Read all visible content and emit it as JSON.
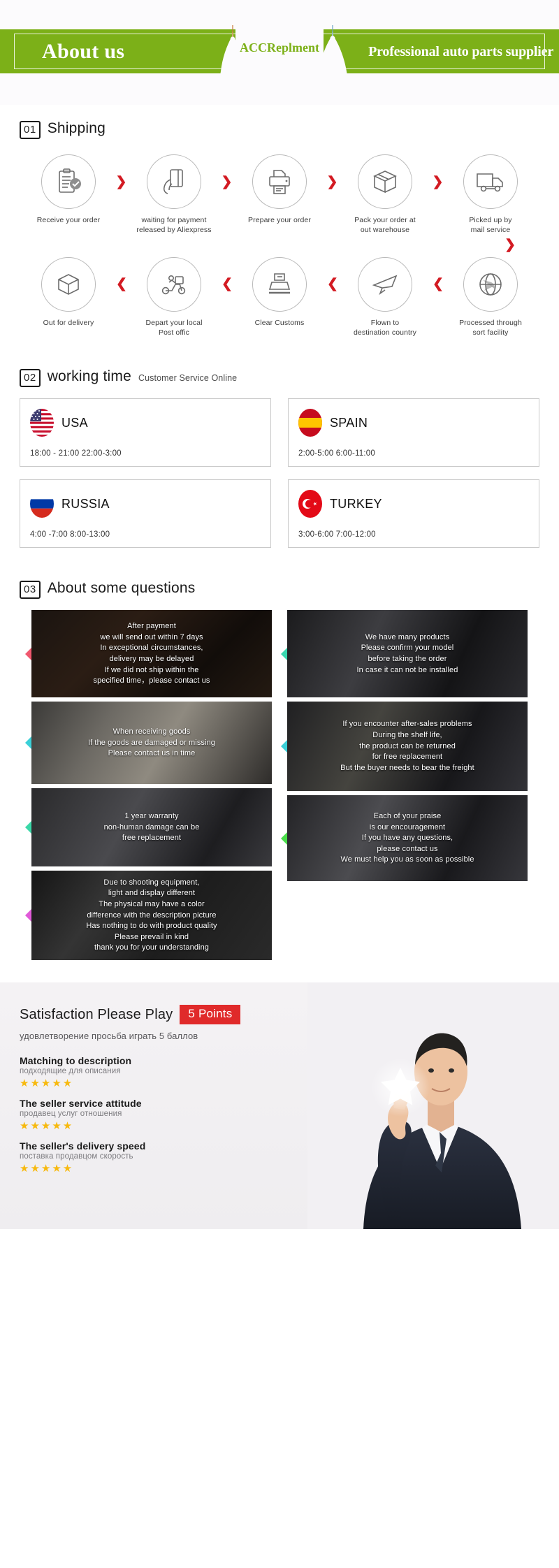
{
  "header": {
    "left_title": "About us",
    "brand": "ACCReplment",
    "right_title": "Professional auto parts supplier",
    "bar_color": "#7cb018"
  },
  "shipping": {
    "number": "01",
    "title": "Shipping",
    "arrow_color": "#d31a22",
    "row1": [
      {
        "icon": "clipboard-check-icon",
        "label": "Receive your order"
      },
      {
        "icon": "hand-card-icon",
        "label": "waiting for payment\nreleased by Aliexpress"
      },
      {
        "icon": "printer-icon",
        "label": "Prepare your order"
      },
      {
        "icon": "package-box-icon",
        "label": "Pack your order at\nout warehouse"
      },
      {
        "icon": "delivery-truck-icon",
        "label": "Picked up by\nmail service"
      }
    ],
    "row2": [
      {
        "icon": "open-box-icon",
        "label": "Out  for delivery"
      },
      {
        "icon": "scooter-courier-icon",
        "label": "Depart your local\nPost offic"
      },
      {
        "icon": "customs-stamp-icon",
        "label": "Clear Customs"
      },
      {
        "icon": "airplane-icon",
        "label": "Flown to\ndestination country"
      },
      {
        "icon": "globe-icon",
        "label": "Processed through\nsort facility"
      }
    ]
  },
  "worktime": {
    "number": "02",
    "title": "working time",
    "subtitle": "Customer Service Online",
    "cards": [
      {
        "flag": "usa-flag-icon",
        "country": "USA",
        "hours": "18:00 - 21:00   22:00-3:00"
      },
      {
        "flag": "spain-flag-icon",
        "country": "SPAIN",
        "hours": "2:00-5:00     6:00-11:00"
      },
      {
        "flag": "russia-flag-icon",
        "country": "RUSSIA",
        "hours": "4:00 -7:00   8:00-13:00"
      },
      {
        "flag": "turkey-flag-icon",
        "country": "TURKEY",
        "hours": "3:00-6:00    7:00-12:00"
      }
    ]
  },
  "questions": {
    "number": "03",
    "title": "About some questions",
    "left": [
      {
        "tip_color": "#f0576e",
        "text": "After payment\nwe will send out within 7 days\nIn exceptional circumstances,\ndelivery may be delayed\nIf we did not ship within the\nspecified time，please contact us"
      },
      {
        "tip_color": "#3ad0d8",
        "text": "When receiving goods\nIf the goods are damaged or missing\nPlease contact us in time"
      },
      {
        "tip_color": "#3ad8a8",
        "text": "1 year warranty\nnon-human damage can be\nfree replacement"
      },
      {
        "tip_color": "#e05ad8",
        "text": "Due to shooting equipment,\nlight and display different\nThe physical may have a color\ndifference with the description picture\nHas nothing to do with product quality\nPlease prevail in kind\nthank you for your understanding"
      }
    ],
    "right": [
      {
        "tip_color": "#3ad8b0",
        "text": "We have many products\nPlease confirm your model\nbefore taking the order\nIn case it can not be installed"
      },
      {
        "tip_color": "#3ad0d8",
        "text": "If you encounter after-sales problems\nDuring the shelf life,\nthe product can be returned\nfor free replacement\nBut the buyer needs to bear the freight"
      },
      {
        "tip_color": "#4ade4a",
        "text": "Each of your praise\nis our encouragement\nIf you have any questions,\nplease contact us\nWe must help you as soon as possible"
      }
    ]
  },
  "satisfaction": {
    "title": "Satisfaction Please Play",
    "badge": "5 Points",
    "badge_color": "#e02a2a",
    "subtitle": "удовлетворение просьба играть 5 баллов",
    "star_color": "#f7b90e",
    "ratings": [
      {
        "en": "Matching to description",
        "ru": "подходящие для описания",
        "stars": "★★★★★"
      },
      {
        "en": "The seller service attitude",
        "ru": "продавец услуг отношения",
        "stars": "★★★★★"
      },
      {
        "en": "The seller's delivery speed",
        "ru": "поставка продавцом скорость",
        "stars": "★★★★★"
      }
    ]
  }
}
